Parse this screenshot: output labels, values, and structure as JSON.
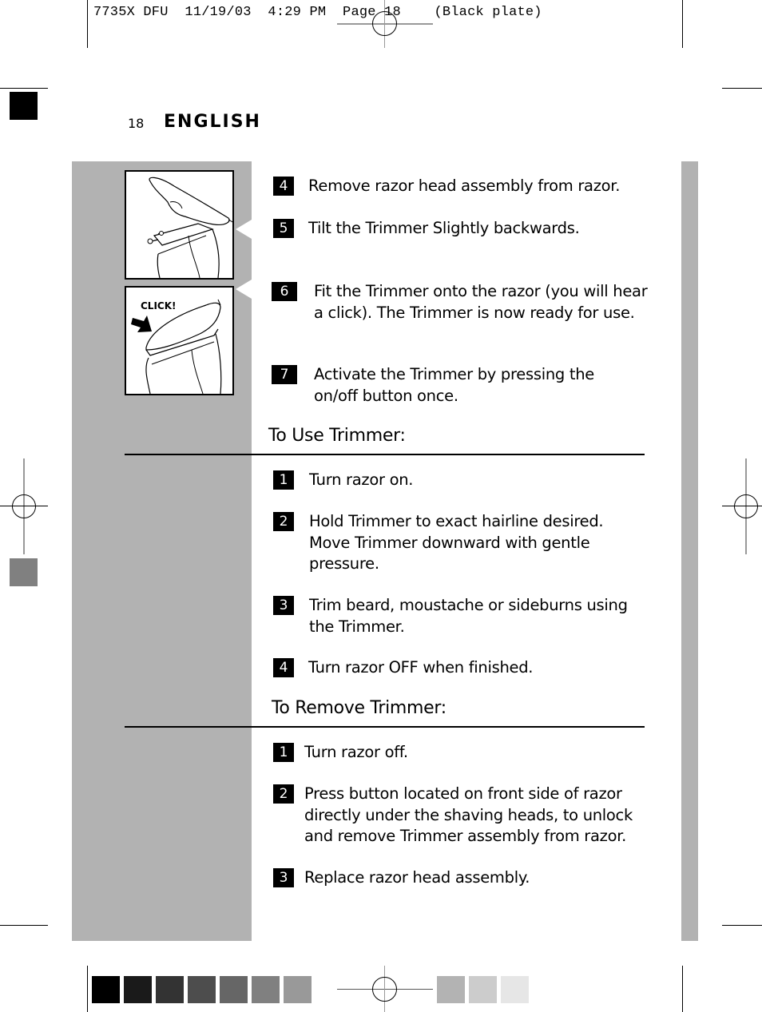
{
  "print_slug": "7735X DFU  11/19/03  4:29 PM  Page 18    (Black plate)",
  "header": {
    "page_number": "18",
    "language": "ENGLISH"
  },
  "illustrations": [
    {
      "name": "trimmer-tilt-illustration",
      "label": ""
    },
    {
      "name": "trimmer-click-illustration",
      "label": "CLICK!"
    }
  ],
  "steps_intro": [
    {
      "num": "4",
      "text": "Remove razor head assembly from razor."
    },
    {
      "num": "5",
      "text": "Tilt the Trimmer Slightly backwards."
    },
    {
      "num": "6",
      "text": "Fit the Trimmer onto the razor (you will hear a click). The Trimmer is now ready for use."
    },
    {
      "num": "7",
      "text": "Activate the Trimmer by pressing the on/off button once."
    }
  ],
  "use_section": {
    "title": "To Use Trimmer:",
    "steps": [
      {
        "num": "1",
        "text": "Turn razor on."
      },
      {
        "num": "2",
        "text": "Hold Trimmer to exact hairline desired. Move Trimmer downward with gentle pressure."
      },
      {
        "num": "3",
        "text": "Trim beard, moustache or sideburns using the Trimmer."
      },
      {
        "num": "4",
        "text": "Turn razor OFF when finished."
      }
    ]
  },
  "remove_section": {
    "title": "To Remove Trimmer:",
    "steps": [
      {
        "num": "1",
        "text": "Turn razor off."
      },
      {
        "num": "2",
        "text": "Press button located on front side of razor directly under the shaving heads, to unlock and remove Trimmer assembly from razor."
      },
      {
        "num": "3",
        "text": "Replace razor head assembly."
      }
    ]
  },
  "color_bar": [
    "#000000",
    "#1a1a1a",
    "#333333",
    "#4d4d4d",
    "#666666",
    "#808080",
    "#999999",
    "#b3b3b3",
    "#cccccc",
    "#e6e6e6"
  ],
  "colors": {
    "panel_grey": "#b2b2b2",
    "side_block_black": "#000000",
    "side_block_grey": "#808080"
  }
}
